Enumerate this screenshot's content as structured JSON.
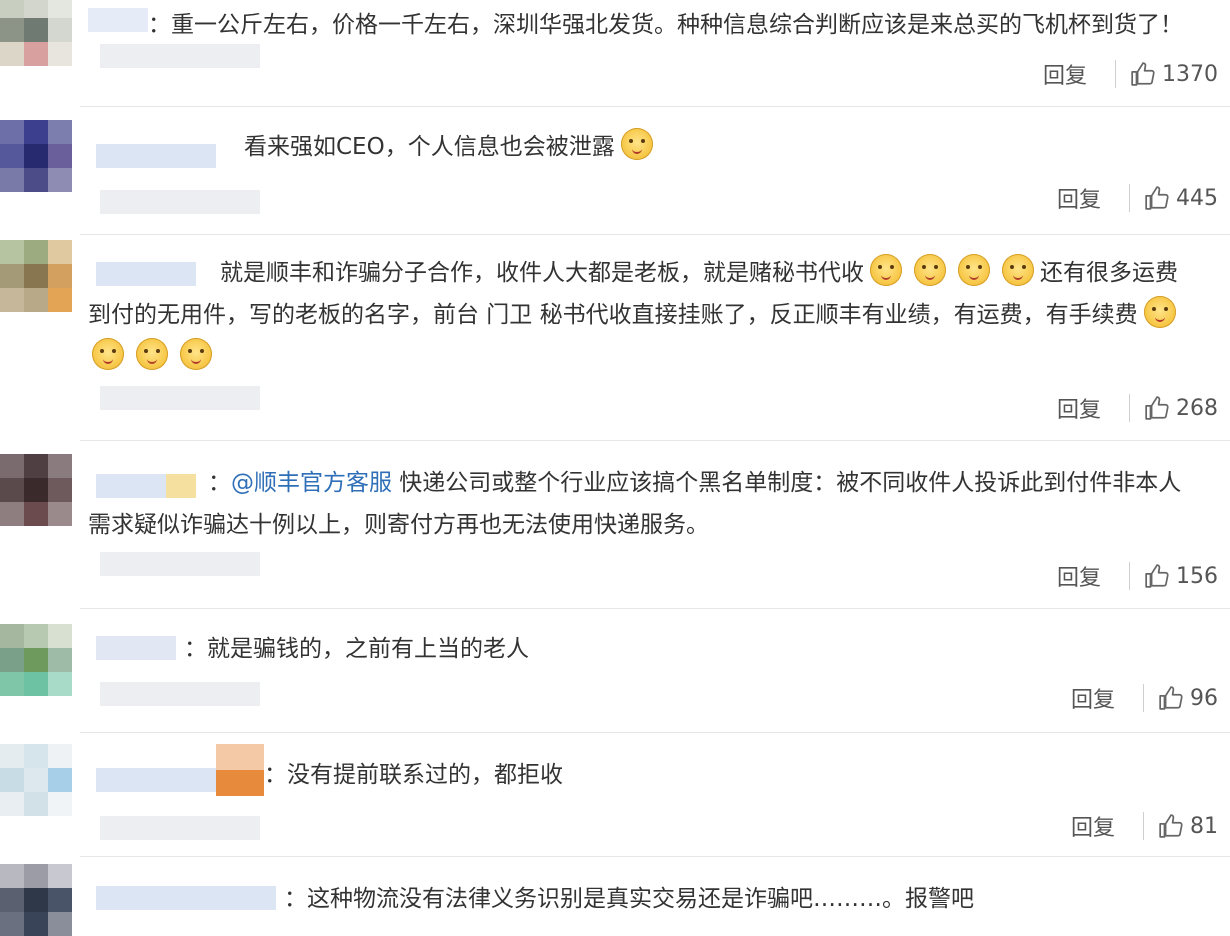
{
  "comments": [
    {
      "text": "：重一公斤左右，价格一千左右，深圳华强北发货。种种信息综合判断应该是来总买的飞机杯到货了！",
      "reply": "回复",
      "likes": "1370"
    },
    {
      "text": "看来强如CEO，个人信息也会被泄露",
      "reply": "回复",
      "likes": "445"
    },
    {
      "line1": "就是顺丰和诈骗分子合作，收件人大都是老板，就是赌秘书代收",
      "line1b": "还有很多运费",
      "line2": "到付的无用件，写的老板的名字，前台 门卫 秘书代收直接挂账了，反正顺丰有业绩，有运费，有手续费",
      "reply": "回复",
      "likes": "268"
    },
    {
      "prefix": "：",
      "mention": "@顺丰官方客服",
      "line1": " 快递公司或整个行业应该搞个黑名单制度：被不同收件人投诉此到付件非本人",
      "line2": "需求疑似诈骗达十例以上，则寄付方再也无法使用快递服务。",
      "reply": "回复",
      "likes": "156"
    },
    {
      "text": "：就是骗钱的，之前有上当的老人",
      "reply": "回复",
      "likes": "96"
    },
    {
      "text": "：没有提前联系过的，都拒收",
      "reply": "回复",
      "likes": "81"
    },
    {
      "text": "：这种物流没有法律义务识别是真实交易还是诈骗吧………。报警吧"
    }
  ],
  "icons": {
    "like": "thumbs-up-icon",
    "emoji": "doge-emoji-icon"
  }
}
